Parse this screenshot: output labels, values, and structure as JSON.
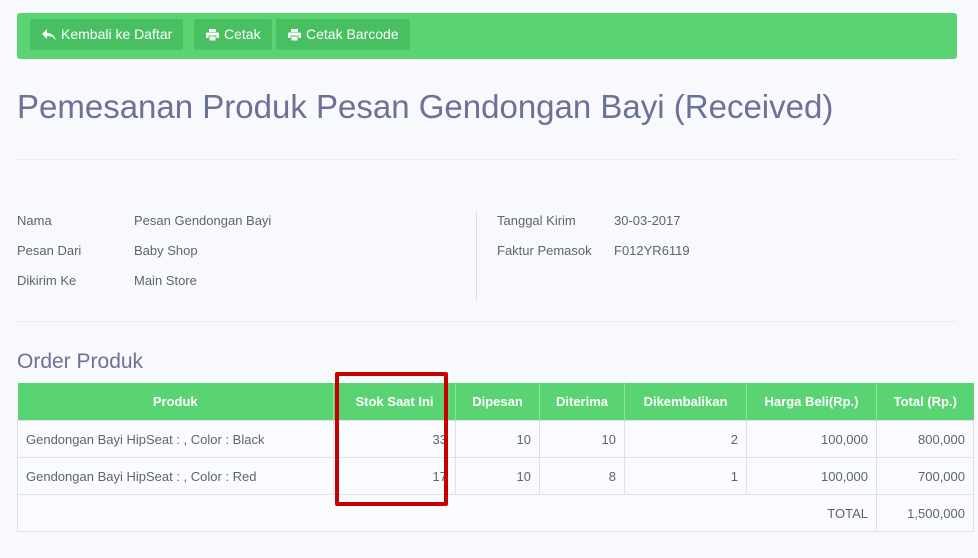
{
  "toolbar": {
    "back_label": "Kembali ke Daftar",
    "print_label": "Cetak",
    "print_barcode_label": "Cetak Barcode"
  },
  "page_title": "Pemesanan Produk Pesan Gendongan Bayi (Received)",
  "info": {
    "name_label": "Nama",
    "name_value": "Pesan Gendongan Bayi",
    "from_label": "Pesan Dari",
    "from_value": "Baby Shop",
    "to_label": "Dikirim Ke",
    "to_value": "Main Store",
    "ship_date_label": "Tanggal Kirim",
    "ship_date_value": "30-03-2017",
    "invoice_label": "Faktur Pemasok",
    "invoice_value": "F012YR6119"
  },
  "order_section_title": "Order Produk",
  "table": {
    "headers": [
      "Produk",
      "Stok Saat Ini",
      "Dipesan",
      "Diterima",
      "Dikembalikan",
      "Harga Beli(Rp.)",
      "Total (Rp.)"
    ],
    "rows": [
      [
        "Gendongan Bayi HipSeat : , Color : Black",
        "33",
        "10",
        "10",
        "2",
        "100,000",
        "800,000"
      ],
      [
        "Gendongan Bayi HipSeat : , Color : Red",
        "17",
        "10",
        "8",
        "1",
        "100,000",
        "700,000"
      ]
    ],
    "total_label": "TOTAL",
    "total_value": "1,500,000"
  },
  "colors": {
    "accent_green": "#5ad373",
    "button_green": "#48bf61",
    "highlight_red": "#c40000",
    "title_color": "#6b7297"
  }
}
